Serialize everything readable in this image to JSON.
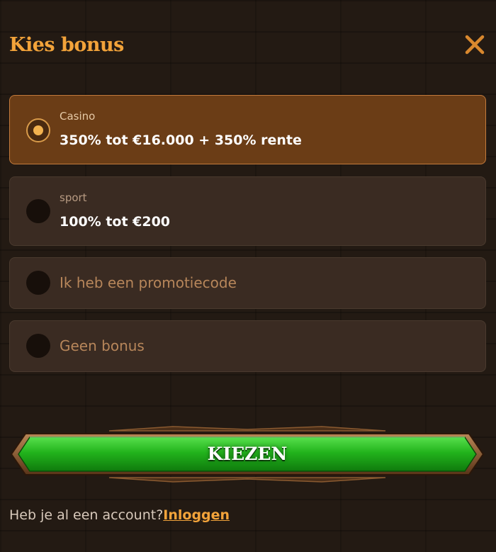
{
  "header": {
    "title": "Kies bonus",
    "close_icon": "close-icon"
  },
  "options": [
    {
      "label": "Casino",
      "value": "350% tot €16.000 + 350% rente",
      "selected": true
    },
    {
      "label": "sport",
      "value": "100% tot €200",
      "selected": false
    },
    {
      "label": "Ik heb een promotiecode",
      "selected": false
    },
    {
      "label": "Geen bonus",
      "selected": false
    }
  ],
  "cta": {
    "label": "KIEZEN"
  },
  "footer": {
    "text": "Heb je al een account?",
    "login": "Inloggen"
  },
  "colors": {
    "accent": "#f2a33a",
    "selected_bg": "#6b3d16",
    "option_bg": "#3a2b22",
    "cta_green": "#1fb81a"
  }
}
